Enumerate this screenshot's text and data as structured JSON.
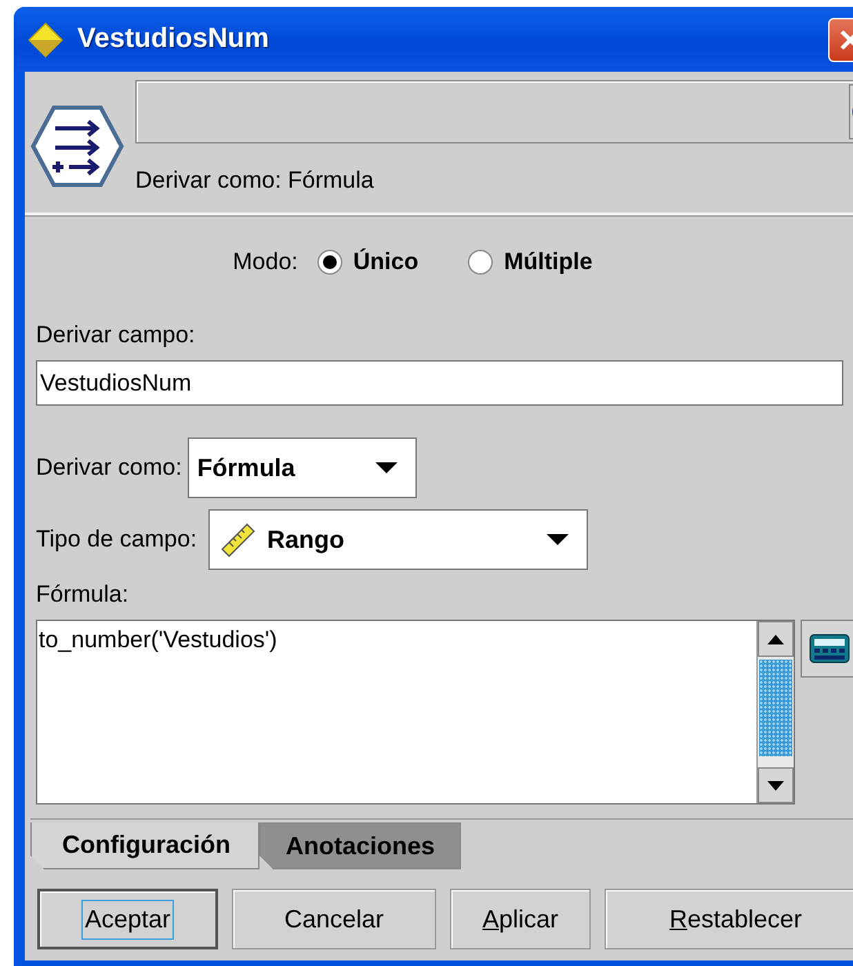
{
  "window": {
    "title": "VestudiosNum"
  },
  "header": {
    "caption": "Derivar como: Fórmula"
  },
  "mode": {
    "label": "Modo:",
    "options": [
      {
        "label": "Único",
        "selected": true
      },
      {
        "label": "Múltiple",
        "selected": false
      }
    ]
  },
  "derive_field": {
    "label": "Derivar campo:",
    "value": "VestudiosNum"
  },
  "derive_as": {
    "label": "Derivar como:",
    "value": "Fórmula"
  },
  "field_type": {
    "label": "Tipo de campo:",
    "value": "Rango"
  },
  "formula": {
    "label": "Fórmula:",
    "value": "to_number('Vestudios')"
  },
  "tabs": [
    {
      "label": "Configuración",
      "selected": true
    },
    {
      "label": "Anotaciones",
      "selected": false
    }
  ],
  "buttons": [
    {
      "label": "Aceptar",
      "default": true,
      "mnemonic_underlined": false
    },
    {
      "label": "Cancelar",
      "default": false,
      "mnemonic_underlined": false
    },
    {
      "label": "Aplicar",
      "default": false,
      "mnemonic_underlined": true
    },
    {
      "label": "Restablecer",
      "default": false,
      "mnemonic_underlined": true
    }
  ]
}
